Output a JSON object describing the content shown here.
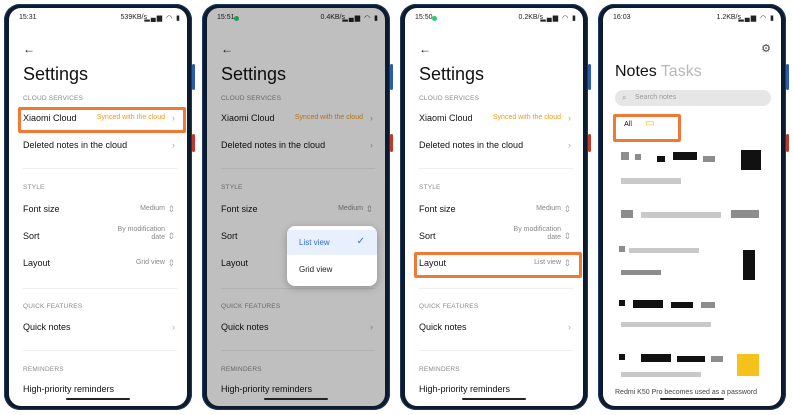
{
  "colors": {
    "accent": "#f07a35",
    "sync_text": "#f29a1a",
    "selected": "#2f6fe0",
    "folder": "#f2b01a"
  },
  "phones": [
    {
      "status": {
        "time": "15:31",
        "rate": "539KB/s"
      },
      "title": "Settings",
      "cloud_label": "CLOUD SERVICES",
      "xiaomi_cloud": "Xiaomi Cloud",
      "xiaomi_cloud_value": "Synced with the cloud",
      "deleted_notes": "Deleted notes in the cloud",
      "style_label": "STYLE",
      "font_size": "Font size",
      "font_size_value": "Medium",
      "sort": "Sort",
      "sort_value_1": "By modification",
      "sort_value_2": "date",
      "layout": "Layout",
      "layout_value": "Grid view",
      "quick_label": "QUICK FEATURES",
      "quick_notes": "Quick notes",
      "reminders_label": "REMINDERS",
      "high_priority": "High-priority reminders"
    },
    {
      "status": {
        "time": "15:51",
        "rate": "0.4KB/s"
      },
      "title": "Settings",
      "cloud_label": "CLOUD SERVICES",
      "xiaomi_cloud": "Xiaomi Cloud",
      "xiaomi_cloud_value": "Synced with the cloud",
      "deleted_notes": "Deleted notes in the cloud",
      "style_label": "STYLE",
      "font_size": "Font size",
      "font_size_value": "Medium",
      "sort": "Sort",
      "layout": "Layout",
      "quick_label": "QUICK FEATURES",
      "quick_notes": "Quick notes",
      "reminders_label": "REMINDERS",
      "high_priority": "High-priority reminders",
      "popup": {
        "options": [
          "List view",
          "Grid view"
        ],
        "selected": "List view"
      }
    },
    {
      "status": {
        "time": "15:50",
        "rate": "0.2KB/s"
      },
      "title": "Settings",
      "cloud_label": "CLOUD SERVICES",
      "xiaomi_cloud": "Xiaomi Cloud",
      "xiaomi_cloud_value": "Synced with the cloud",
      "deleted_notes": "Deleted notes in the cloud",
      "style_label": "STYLE",
      "font_size": "Font size",
      "font_size_value": "Medium",
      "sort": "Sort",
      "sort_value_1": "By modification",
      "sort_value_2": "date",
      "layout": "Layout",
      "layout_value": "List view",
      "quick_label": "QUICK FEATURES",
      "quick_notes": "Quick notes",
      "reminders_label": "REMINDERS",
      "high_priority": "High-priority reminders"
    },
    {
      "status": {
        "time": "16:03",
        "rate": "1.2KB/s"
      },
      "tab_notes": "Notes",
      "tab_tasks": "Tasks",
      "search_placeholder": "Search notes",
      "filter_all": "All",
      "partial_note": "Redmi K50 Pro becomes used as a password"
    }
  ]
}
